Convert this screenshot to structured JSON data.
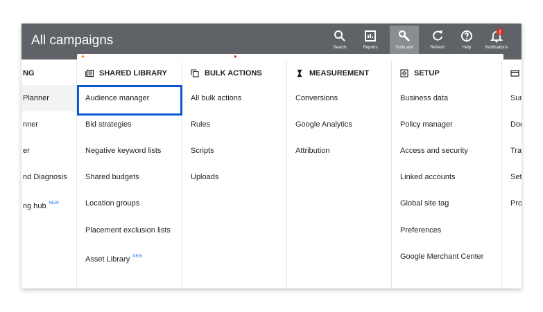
{
  "header": {
    "title": "All campaigns",
    "tools": [
      {
        "label": "Search",
        "icon": "search-icon"
      },
      {
        "label": "Reports",
        "icon": "reports-icon"
      },
      {
        "label": "Tools and",
        "icon": "wrench-icon"
      },
      {
        "label": "Refresh",
        "icon": "refresh-icon"
      },
      {
        "label": "Help",
        "icon": "help-icon"
      },
      {
        "label": "Notifications",
        "icon": "bell-icon"
      }
    ],
    "notification_badge": "!"
  },
  "columns": {
    "planning": {
      "heading": "NG",
      "items": [
        "Planner",
        "nner",
        "er",
        "nd Diagnosis",
        "ng hub"
      ],
      "new_badge": "NEW"
    },
    "shared_library": {
      "heading": "SHARED LIBRARY",
      "icon": "library-icon",
      "items": [
        "Audience manager",
        "Bid strategies",
        "Negative keyword lists",
        "Shared budgets",
        "Location groups",
        "Placement exclusion lists",
        "Asset Library"
      ],
      "new_badge": "NEW"
    },
    "bulk_actions": {
      "heading": "BULK ACTIONS",
      "icon": "copy-icon",
      "items": [
        "All bulk actions",
        "Rules",
        "Scripts",
        "Uploads"
      ]
    },
    "measurement": {
      "heading": "MEASUREMENT",
      "icon": "hourglass-icon",
      "items": [
        "Conversions",
        "Google Analytics",
        "Attribution"
      ]
    },
    "setup": {
      "heading": "SETUP",
      "icon": "setup-icon",
      "items": [
        "Business data",
        "Policy manager",
        "Access and security",
        "Linked accounts",
        "Global site tag",
        "Preferences",
        "Google Merchant Center"
      ]
    },
    "billing": {
      "heading": "",
      "icon": "card-icon",
      "items": [
        "Sun",
        "Doc",
        "Trar",
        "Sett",
        "Proi"
      ]
    }
  },
  "colors": {
    "topbar": "#5f6368",
    "accent": "#0b57d0",
    "badge": "#d93025",
    "new_badge": "#1a73e8"
  }
}
